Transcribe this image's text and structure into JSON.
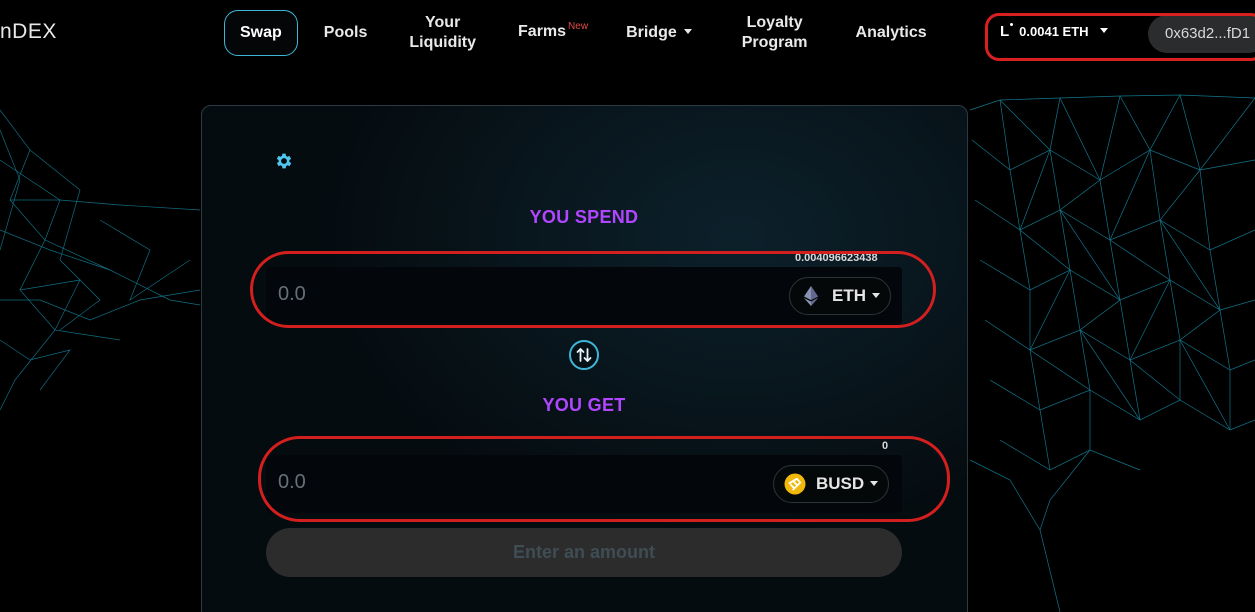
{
  "brand": {
    "logo_text": "nDEX"
  },
  "nav": {
    "swap": "Swap",
    "pools": "Pools",
    "liquidity_line1": "Your",
    "liquidity_line2": "Liquidity",
    "farms": "Farms",
    "farms_badge": "New",
    "bridge": "Bridge",
    "loyalty_line1": "Loyalty",
    "loyalty_line2": "Program",
    "analytics": "Analytics"
  },
  "account": {
    "network_logo": "L",
    "balance": "0.0041 ETH",
    "address": "0x63d2...fD1"
  },
  "swap": {
    "spend_label": "YOU SPEND",
    "spend_value": "0.0",
    "spend_balance": "0.004096623438",
    "spend_token": "ETH",
    "get_label": "YOU GET",
    "get_value": "0.0",
    "get_balance": "0",
    "get_token": "BUSD",
    "submit_label": "Enter an amount"
  },
  "icons": {
    "settings": "gear-icon",
    "switch": "swap-arrows-icon",
    "eth": "ethereum-icon",
    "busd": "busd-icon"
  },
  "colors": {
    "accent": "#3fb6d8",
    "section_label": "#b046ff",
    "highlight_ring": "#d41f1f",
    "new_badge": "#e04a4a",
    "busd": "#f0b90b"
  }
}
